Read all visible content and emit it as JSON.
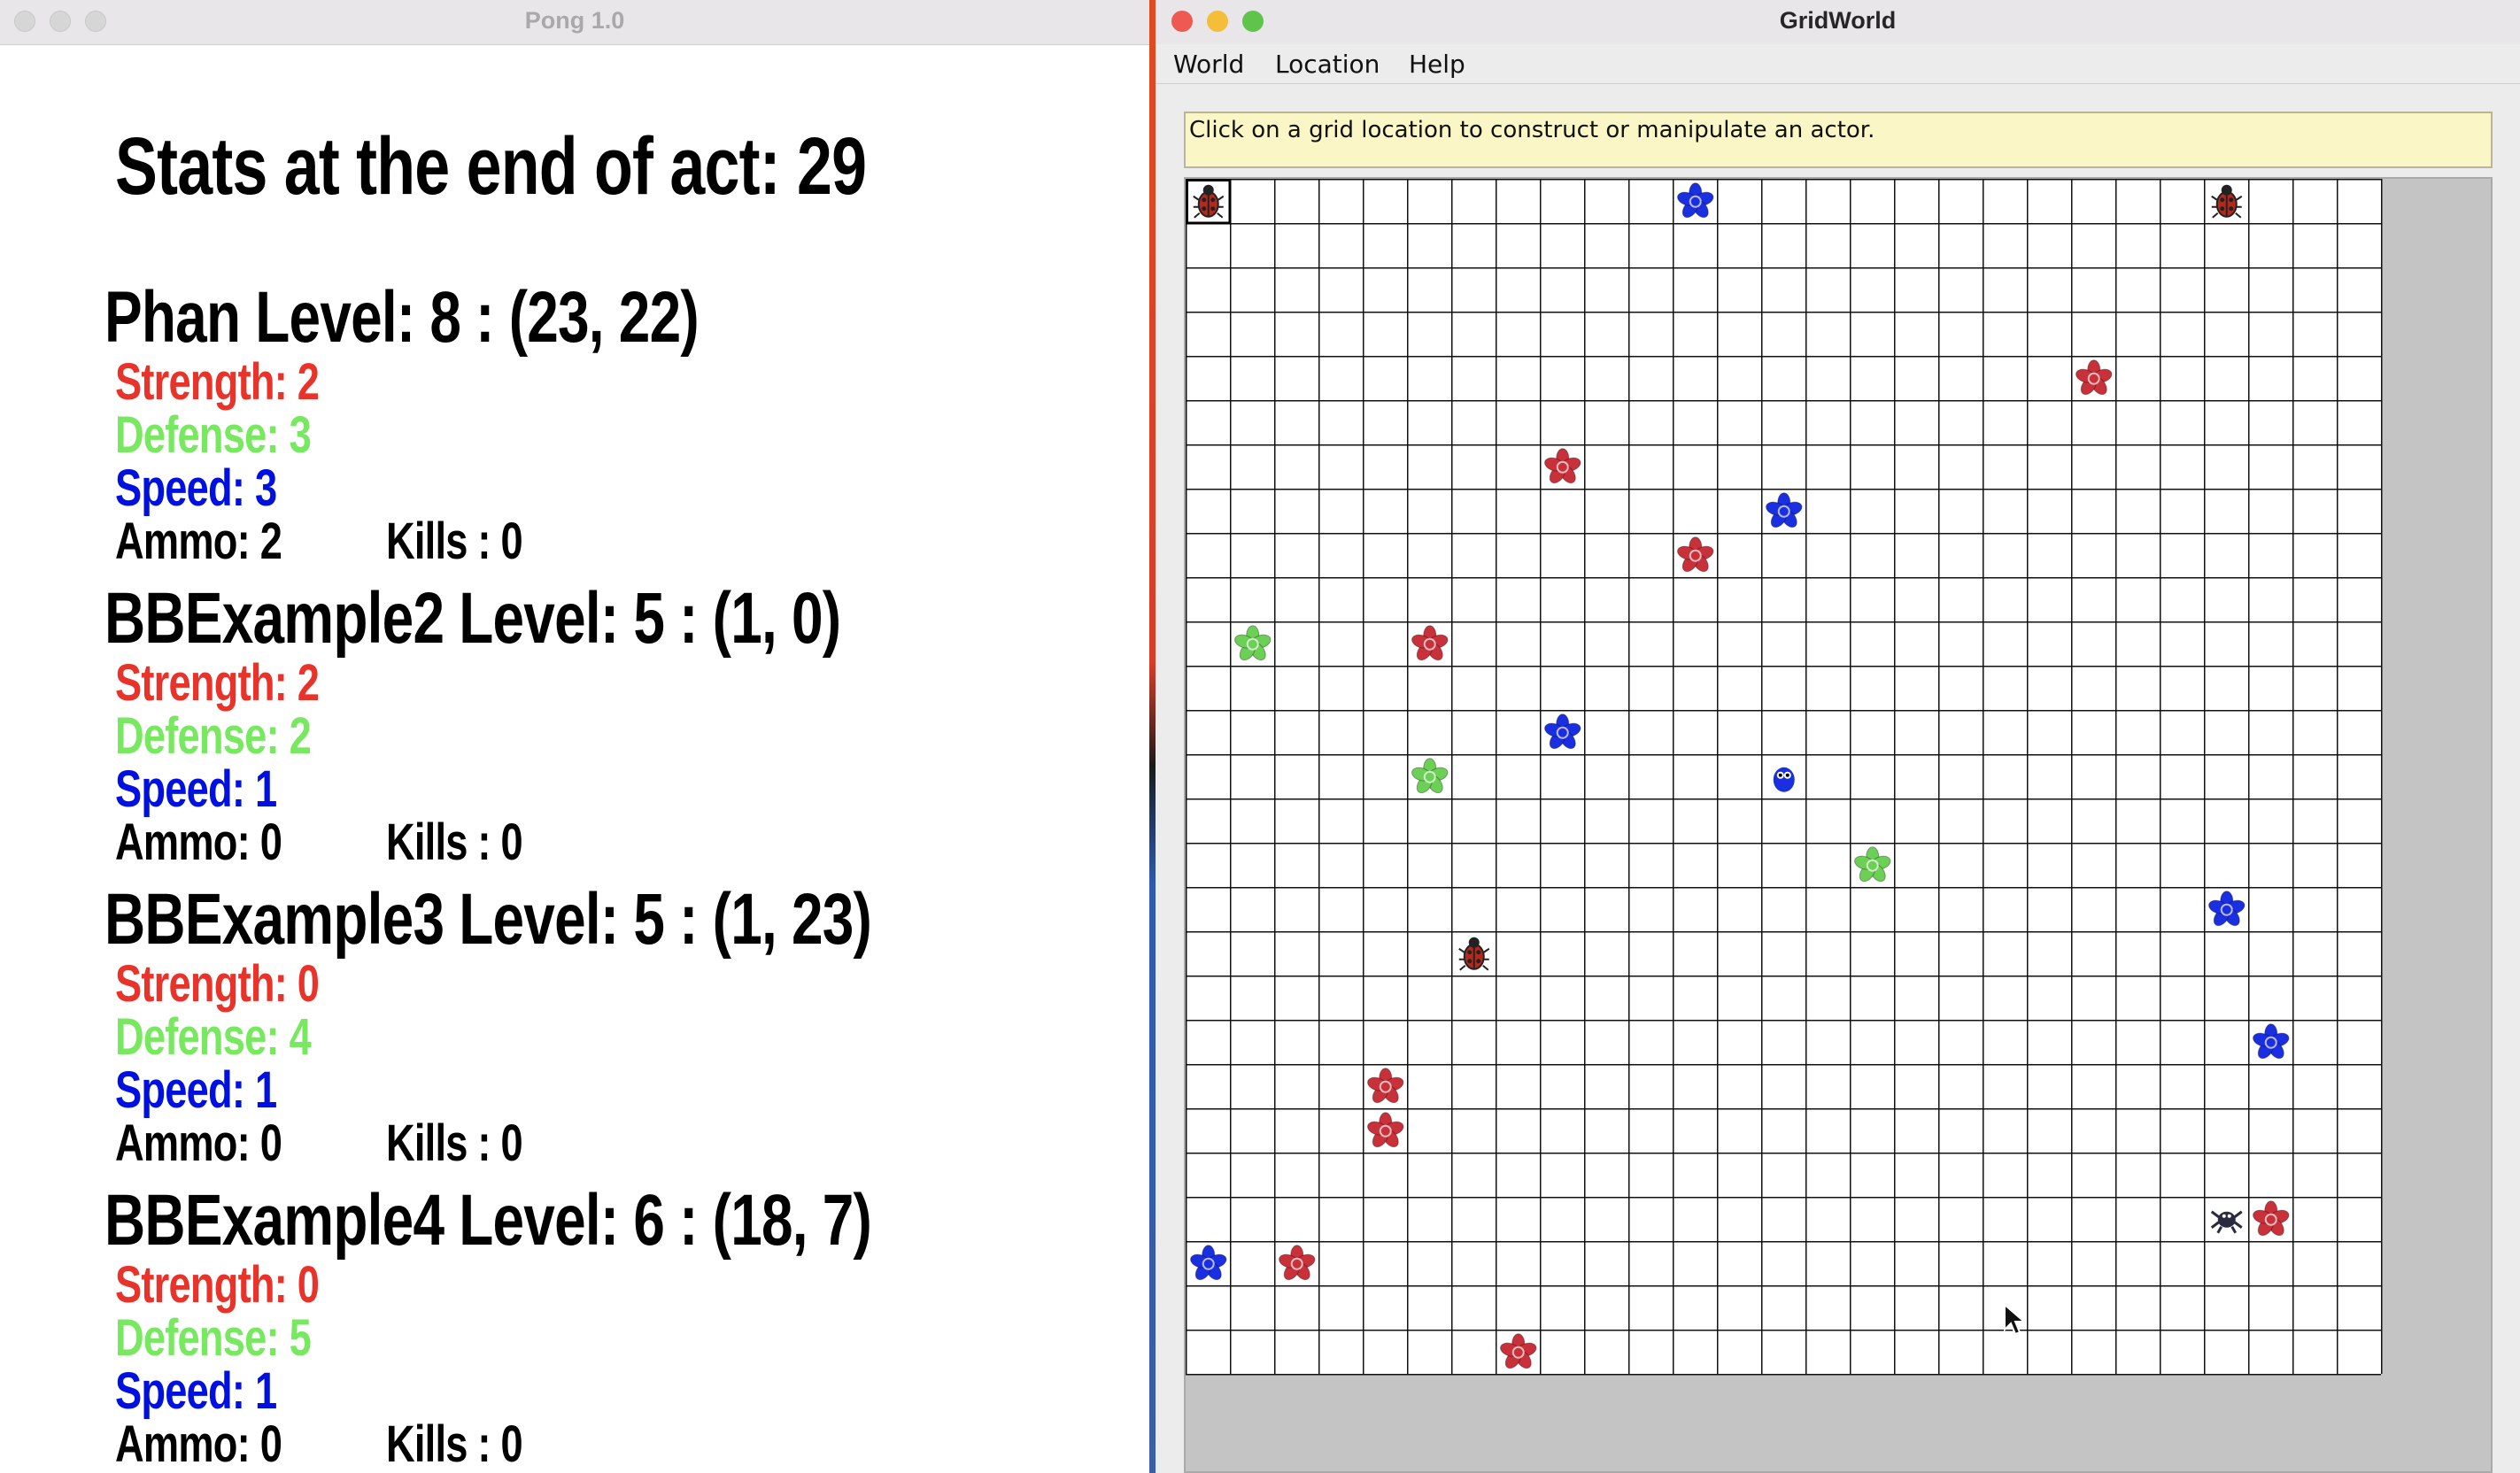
{
  "pong": {
    "title": "Pong 1.0",
    "heading": "Stats at the end of act: 29",
    "players": [
      {
        "header": "Phan Level: 8  : (23, 22)",
        "strength": "Strength: 2",
        "defense": "Defense: 3",
        "speed": "Speed: 3",
        "ammo": "Ammo: 2",
        "kills": "Kills : 0"
      },
      {
        "header": "BBExample2 Level: 5  : (1, 0)",
        "strength": "Strength: 2",
        "defense": "Defense: 2",
        "speed": "Speed: 1",
        "ammo": "Ammo: 0",
        "kills": "Kills : 0"
      },
      {
        "header": "BBExample3 Level: 5  : (1, 23)",
        "strength": "Strength: 0",
        "defense": "Defense: 4",
        "speed": "Speed: 1",
        "ammo": "Ammo: 0",
        "kills": "Kills : 0"
      },
      {
        "header": "BBExample4 Level: 6  : (18, 7)",
        "strength": "Strength: 0",
        "defense": "Defense: 5",
        "speed": "Speed: 1",
        "ammo": "Ammo: 0",
        "kills": "Kills : 0"
      }
    ]
  },
  "gridworld": {
    "title": "GridWorld",
    "menus": [
      "World",
      "Location",
      "Help"
    ],
    "message": "Click on a grid location to construct or manipulate an actor.",
    "rows": 27,
    "cols": 27,
    "colors": {
      "red": "#c8303a",
      "blue": "#1a2fe0",
      "green": "#6ccf56",
      "bug": "#b22a1e"
    },
    "actors": [
      {
        "type": "bug",
        "row": 0,
        "col": 0,
        "selected": true
      },
      {
        "type": "flower",
        "color": "blue",
        "row": 0,
        "col": 11
      },
      {
        "type": "bug",
        "row": 0,
        "col": 23
      },
      {
        "type": "flower",
        "color": "red",
        "row": 4,
        "col": 20
      },
      {
        "type": "flower",
        "color": "red",
        "row": 6,
        "col": 8
      },
      {
        "type": "flower",
        "color": "blue",
        "row": 7,
        "col": 13
      },
      {
        "type": "flower",
        "color": "red",
        "row": 8,
        "col": 11
      },
      {
        "type": "flower",
        "color": "green",
        "row": 10,
        "col": 1
      },
      {
        "type": "flower",
        "color": "red",
        "row": 10,
        "col": 5
      },
      {
        "type": "flower",
        "color": "blue",
        "row": 12,
        "col": 8
      },
      {
        "type": "flower",
        "color": "green",
        "row": 13,
        "col": 5
      },
      {
        "type": "critter",
        "row": 13,
        "col": 13
      },
      {
        "type": "flower",
        "color": "green",
        "row": 15,
        "col": 15
      },
      {
        "type": "flower",
        "color": "blue",
        "row": 16,
        "col": 23
      },
      {
        "type": "bug",
        "row": 17,
        "col": 6
      },
      {
        "type": "flower",
        "color": "blue",
        "row": 19,
        "col": 24
      },
      {
        "type": "flower",
        "color": "red",
        "row": 20,
        "col": 4
      },
      {
        "type": "flower",
        "color": "red",
        "row": 21,
        "col": 4
      },
      {
        "type": "crab",
        "row": 23,
        "col": 23
      },
      {
        "type": "flower",
        "color": "red",
        "row": 23,
        "col": 24
      },
      {
        "type": "flower",
        "color": "blue",
        "row": 24,
        "col": 0
      },
      {
        "type": "flower",
        "color": "red",
        "row": 24,
        "col": 2
      },
      {
        "type": "flower",
        "color": "red",
        "row": 26,
        "col": 7
      }
    ]
  }
}
